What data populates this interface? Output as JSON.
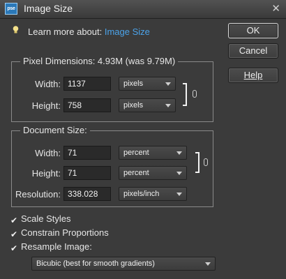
{
  "window": {
    "title": "Image Size",
    "app_icon_text": "pse",
    "close_symbol": "✕"
  },
  "learn_more": {
    "prefix": "Learn more about: ",
    "link": "Image Size"
  },
  "buttons": {
    "ok": "OK",
    "cancel": "Cancel",
    "help": "Help"
  },
  "pixel_dimensions": {
    "legend": "Pixel Dimensions:  4.93M (was 9.79M)",
    "width_label": "Width:",
    "width_value": "1137",
    "width_unit": "pixels",
    "height_label": "Height:",
    "height_value": "758",
    "height_unit": "pixels"
  },
  "document_size": {
    "legend": "Document Size:",
    "width_label": "Width:",
    "width_value": "71",
    "width_unit": "percent",
    "height_label": "Height:",
    "height_value": "71",
    "height_unit": "percent",
    "resolution_label": "Resolution:",
    "resolution_value": "338.028",
    "resolution_unit": "pixels/inch"
  },
  "options": {
    "scale_styles": {
      "label": "Scale Styles",
      "checked": true
    },
    "constrain_proportions": {
      "label": "Constrain Proportions",
      "checked": true
    },
    "resample_image": {
      "label": "Resample Image:",
      "checked": true
    },
    "resample_method": "Bicubic (best for smooth gradients)"
  },
  "colors": {
    "background": "#3b3b3b",
    "link": "#4ba3ea",
    "text": "#e6e6e6"
  }
}
